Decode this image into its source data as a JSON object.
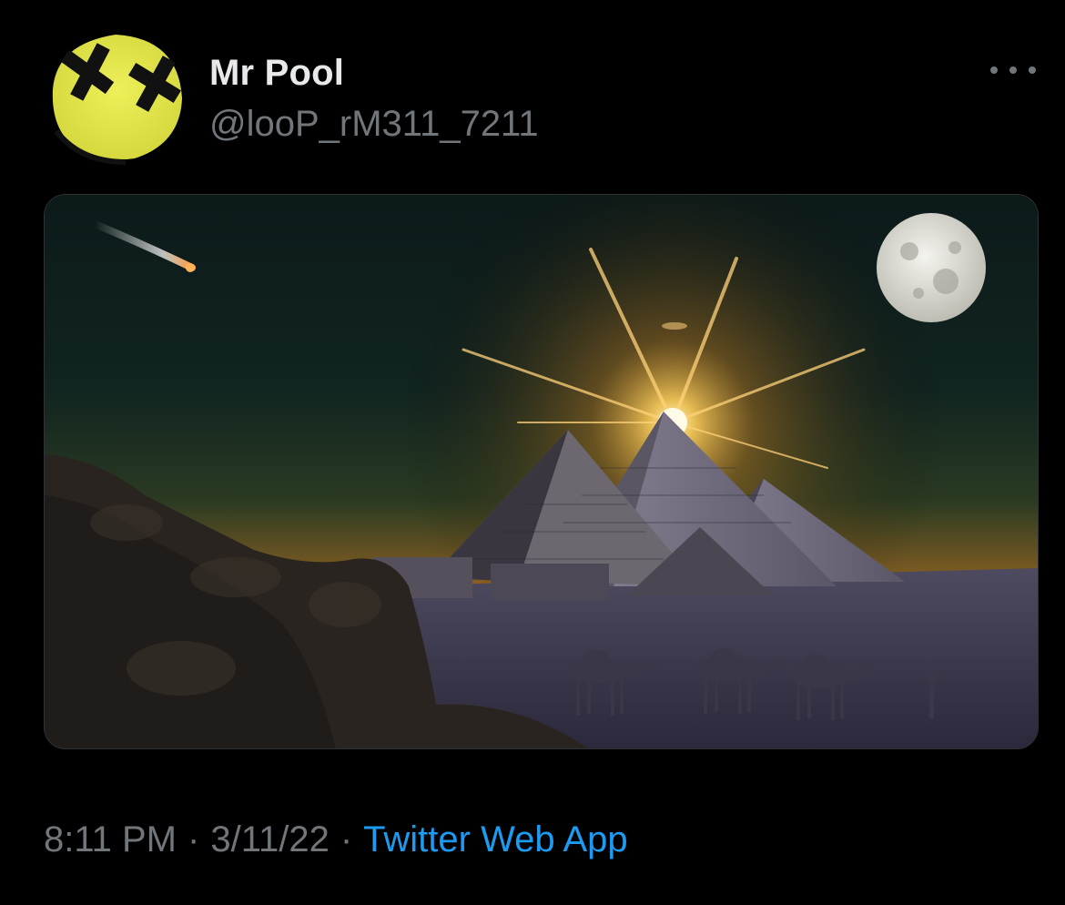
{
  "author": {
    "display_name": "Mr Pool",
    "handle": "@looP_rM311_7211"
  },
  "meta": {
    "time": "8:11 PM",
    "separator": "·",
    "date": "3/11/22",
    "source": "Twitter Web App"
  },
  "icons": {
    "more": "more-dots-icon"
  },
  "colors": {
    "background": "#000000",
    "primary_text": "#e7e9ea",
    "secondary_text": "#71767b",
    "link": "#1d9bf0",
    "avatar_face": "#e6e84a"
  }
}
